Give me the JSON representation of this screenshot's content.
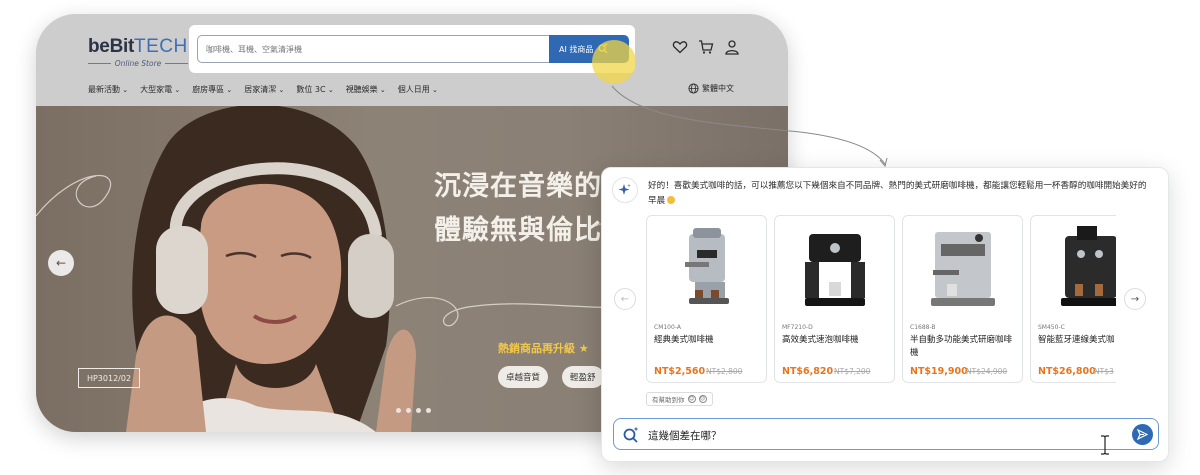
{
  "store": {
    "logo_main": "beBit",
    "logo_tech": "TECH",
    "logo_sub": "Online Store",
    "search_placeholder": "咖啡機、耳機、空氣清淨機",
    "ai_button_label": "AI 找商品",
    "nav_items": [
      "最新活動",
      "大型家電",
      "廚房專區",
      "居家清潔",
      "數位 3C",
      "視聽娛樂",
      "個人日用"
    ],
    "language": "繁體中文",
    "icons": [
      "heart-icon",
      "cart-icon",
      "user-icon",
      "globe-icon"
    ]
  },
  "hero": {
    "title_line1": "沉浸在音樂的",
    "title_line2": "體驗無與倫比",
    "promo": "熱銷商品再升級",
    "pills": [
      "卓越音質",
      "輕盈舒"
    ],
    "model_tag": "HP3012/02",
    "slide_dots": 4
  },
  "chat": {
    "assistant_message": "好的！喜歡美式咖啡的話，可以推薦您以下幾個來自不同品牌、熱門的美式研磨咖啡機，都能讓您輕鬆用一杯香醇的咖啡開始美好的早晨",
    "products": [
      {
        "sku": "CM100-A",
        "name": "經典美式咖啡機",
        "price": "NT$2,560",
        "old_price": "NT$2,800"
      },
      {
        "sku": "MF7210-D",
        "name": "高效美式速泡咖啡機",
        "price": "NT$6,820",
        "old_price": "NT$7,200"
      },
      {
        "sku": "C1688-B",
        "name": "半自動多功能美式研磨咖啡機",
        "price": "NT$19,900",
        "old_price": "NT$24,900"
      },
      {
        "sku": "SM450-C",
        "name": "智能藍牙連線美式咖",
        "price": "NT$26,800",
        "old_price": "NT$3"
      }
    ],
    "feedback_label": "有幫助到你",
    "input_value": "這幾個差在哪？",
    "colors": {
      "accent": "#2f69b4",
      "price": "#e8741b",
      "highlight": "#f0d646"
    }
  }
}
